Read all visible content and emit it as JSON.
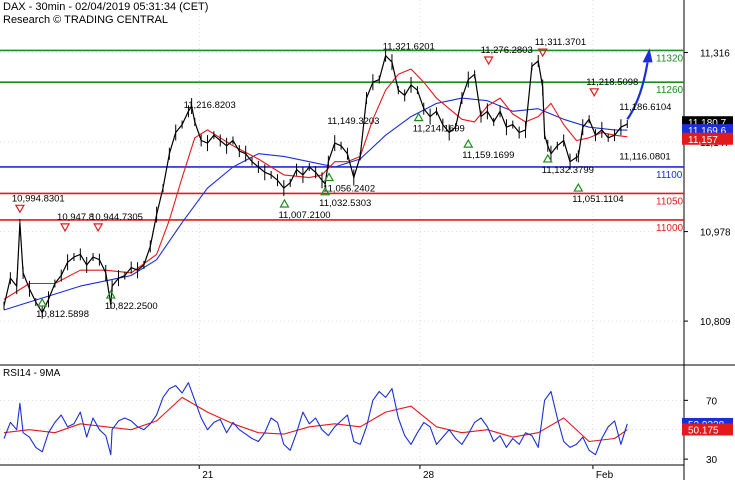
{
  "header": {
    "title": "DAX - 30min - 02/04/2019 05:31:34 (CET)",
    "source": "Research © TRADING CENTRAL"
  },
  "colors": {
    "price": "#000000",
    "ma_fast": "#e31a1c",
    "ma_slow": "#1c2fd6",
    "resistance": "#1e8c1e",
    "pivot": "#1c2fd6",
    "support": "#e31a1c",
    "arrow": "#1c2fd6",
    "up_marker": "#1e8c1e",
    "down_marker": "#e31a1c",
    "rsi": "#1c2fd6",
    "rsi_ma": "#e31a1c",
    "grid": "#c8c8c8"
  },
  "chart_data": [
    {
      "type": "line",
      "panel": "price",
      "ylim": [
        10745,
        11368
      ],
      "xlim": [
        0,
        100
      ],
      "y_ticks": [
        "11,316",
        "11,147",
        "10,978",
        "10,809"
      ],
      "x_ticks": [
        {
          "x": 30.7,
          "label": "21"
        },
        {
          "x": 65.4,
          "label": "28"
        },
        {
          "x": 92.6,
          "label": "Feb"
        }
      ],
      "levels": [
        {
          "value": 11320,
          "label": "11320",
          "kind": "resistance"
        },
        {
          "value": 11260,
          "label": "11260",
          "kind": "resistance"
        },
        {
          "value": 11100,
          "label": "11100",
          "kind": "pivot"
        },
        {
          "value": 11050,
          "label": "11050",
          "kind": "support"
        },
        {
          "value": 11000,
          "label": "11000",
          "kind": "support"
        }
      ],
      "price_tags": [
        {
          "value": 11180.7,
          "label": "11,180.7",
          "color": "#000000"
        },
        {
          "value": 11169.6,
          "label": "11,169.6",
          "color": "#1c2fd6"
        },
        {
          "value": 11157,
          "label": "11,157",
          "color": "#e31a1c"
        }
      ],
      "annotations": [
        {
          "x": 2.5,
          "y": 11020,
          "label": "10,994.8301",
          "marker": "down"
        },
        {
          "x": 9.6,
          "y": 10985,
          "label": "10,947.8",
          "marker": "down"
        },
        {
          "x": 14.8,
          "y": 10985,
          "label": "10,944.7305",
          "marker": "down"
        },
        {
          "x": 6.0,
          "y": 10845,
          "label": "10,812.5898",
          "marker": "up"
        },
        {
          "x": 16.8,
          "y": 10860,
          "label": "10,822.2500",
          "marker": "up"
        },
        {
          "x": 29.5,
          "y": 11200,
          "label": "11,216.8203",
          "marker": "none"
        },
        {
          "x": 60.8,
          "y": 11310,
          "label": "11,321.6201",
          "marker": "none"
        },
        {
          "x": 52.1,
          "y": 11170,
          "label": "11,149.3203",
          "marker": "none"
        },
        {
          "x": 65.2,
          "y": 11195,
          "label": "11,214.1699",
          "marker": "up"
        },
        {
          "x": 73.0,
          "y": 11145,
          "label": "11,159.1699",
          "marker": "up"
        },
        {
          "x": 76.2,
          "y": 11300,
          "label": "11,276.2803",
          "marker": "down"
        },
        {
          "x": 84.7,
          "y": 11315,
          "label": "11,311.3701",
          "marker": "down"
        },
        {
          "x": 92.8,
          "y": 11240,
          "label": "11,218.5098",
          "marker": "down"
        },
        {
          "x": 98.0,
          "y": 11196,
          "label": "11,186.6104",
          "marker": "none"
        },
        {
          "x": 85.5,
          "y": 11117,
          "label": "11,132.3799",
          "marker": "up"
        },
        {
          "x": 98.0,
          "y": 11103,
          "label": "11,116.0801",
          "marker": "none"
        },
        {
          "x": 51.1,
          "y": 11082,
          "label": "11,056.2402",
          "marker": "up"
        },
        {
          "x": 50.5,
          "y": 11055,
          "label": "11,032.5303",
          "marker": "up"
        },
        {
          "x": 44.1,
          "y": 11032,
          "label": "11,007.2100",
          "marker": "up"
        },
        {
          "x": 90.3,
          "y": 11062,
          "label": "11,051.1104",
          "marker": "up"
        }
      ],
      "series": [
        {
          "name": "price",
          "x": [
            0,
            1,
            2,
            2.5,
            3,
            4,
            5,
            6,
            7,
            8,
            9,
            10,
            11,
            12,
            13,
            14,
            15,
            16,
            16.8,
            17,
            18,
            19,
            20,
            21,
            22,
            23,
            24,
            25,
            26,
            27,
            28,
            29,
            29.5,
            30,
            31,
            32,
            33,
            34,
            35,
            36,
            37,
            38,
            39,
            40,
            41,
            42,
            43,
            44,
            45,
            46,
            47,
            48,
            49,
            50,
            50.5,
            51,
            52,
            53,
            54,
            55,
            56,
            57,
            58,
            59,
            60,
            61,
            62,
            63,
            64,
            65,
            66,
            67,
            68,
            69,
            70,
            71,
            72,
            73,
            74,
            75,
            76,
            77,
            78,
            79,
            80,
            81,
            82,
            83,
            84,
            84.7,
            85,
            85.5,
            86,
            87,
            88,
            89,
            90,
            90.3,
            91,
            92,
            93,
            94,
            95,
            96,
            97,
            98
          ],
          "y": [
            10838,
            10890,
            10875,
            10994,
            10900,
            10870,
            10845,
            10825,
            10850,
            10880,
            10895,
            10920,
            10930,
            10935,
            10915,
            10930,
            10925,
            10900,
            10840,
            10875,
            10890,
            10895,
            10910,
            10905,
            10915,
            10950,
            11010,
            11060,
            11125,
            11165,
            11180,
            11205,
            11215,
            11185,
            11150,
            11145,
            11160,
            11150,
            11140,
            11150,
            11130,
            11125,
            11110,
            11100,
            11090,
            11085,
            11075,
            11060,
            11070,
            11095,
            11085,
            11100,
            11090,
            11075,
            11068,
            11110,
            11145,
            11140,
            11125,
            11080,
            11120,
            11230,
            11260,
            11265,
            11310,
            11298,
            11245,
            11235,
            11255,
            11245,
            11210,
            11195,
            11205,
            11180,
            11165,
            11175,
            11230,
            11265,
            11275,
            11195,
            11205,
            11185,
            11205,
            11175,
            11180,
            11165,
            11170,
            11290,
            11300,
            11250,
            11160,
            11140,
            11125,
            11140,
            11150,
            11110,
            11118,
            11120,
            11175,
            11190,
            11160,
            11170,
            11155,
            11160,
            11175,
            11181
          ]
        },
        {
          "name": "ma_fast",
          "x": [
            0,
            4,
            8,
            12,
            16,
            20,
            24,
            26,
            28,
            30,
            32,
            34,
            36,
            40,
            44,
            48,
            50,
            52,
            54,
            56,
            58,
            60,
            62,
            64,
            66,
            68,
            70,
            72,
            74,
            76,
            78,
            80,
            82,
            84,
            86,
            88,
            90,
            92,
            94,
            96,
            98
          ],
          "y": [
            10850,
            10880,
            10880,
            10905,
            10905,
            10900,
            10935,
            11000,
            11080,
            11155,
            11170,
            11155,
            11140,
            11115,
            11085,
            11080,
            11085,
            11110,
            11110,
            11120,
            11190,
            11245,
            11275,
            11285,
            11260,
            11230,
            11210,
            11190,
            11185,
            11215,
            11230,
            11200,
            11185,
            11195,
            11220,
            11180,
            11150,
            11155,
            11165,
            11160,
            11157
          ]
        },
        {
          "name": "ma_slow",
          "x": [
            0,
            4,
            8,
            12,
            16,
            20,
            24,
            28,
            32,
            36,
            40,
            44,
            48,
            52,
            56,
            60,
            64,
            68,
            72,
            76,
            80,
            84,
            88,
            92,
            96,
            98
          ],
          "y": [
            10830,
            10845,
            10860,
            10875,
            10885,
            10895,
            10925,
            10995,
            11060,
            11100,
            11125,
            11120,
            11110,
            11100,
            11115,
            11160,
            11195,
            11220,
            11230,
            11225,
            11205,
            11210,
            11190,
            11175,
            11170,
            11169.6
          ]
        }
      ],
      "forecast_arrow": {
        "x": [
          98,
          101.5
        ],
        "y": [
          11190,
          11320
        ]
      }
    },
    {
      "type": "line",
      "panel": "rsi",
      "title": "RSI14 - 9MA",
      "ylim": [
        26,
        92
      ],
      "y_ticks": [
        "70",
        "50",
        "30"
      ],
      "price_tags": [
        {
          "value": 53.93,
          "label": "53.9328",
          "color": "#1c2fd6"
        },
        {
          "value": 50.18,
          "label": "50.175",
          "color": "#e31a1c"
        }
      ],
      "series": [
        {
          "name": "rsi",
          "x": [
            0,
            1,
            2,
            2.5,
            3,
            4,
            5,
            6,
            7,
            8,
            9,
            10,
            11,
            12,
            13,
            14,
            15,
            16,
            16.8,
            17,
            18,
            19,
            20,
            21,
            22,
            23,
            24,
            25,
            26,
            27,
            28,
            29,
            30,
            31,
            32,
            33,
            34,
            35,
            36,
            37,
            38,
            39,
            40,
            41,
            42,
            43,
            44,
            45,
            46,
            47,
            48,
            49,
            50,
            51,
            52,
            53,
            54,
            55,
            56,
            57,
            58,
            59,
            60,
            61,
            62,
            63,
            64,
            65,
            66,
            67,
            68,
            69,
            70,
            71,
            72,
            73,
            74,
            75,
            76,
            77,
            78,
            79,
            80,
            81,
            82,
            83,
            84,
            85,
            86,
            87,
            88,
            89,
            90,
            91,
            92,
            93,
            94,
            95,
            96,
            97,
            98
          ],
          "y": [
            44,
            55,
            50,
            68,
            48,
            45,
            38,
            35,
            48,
            55,
            60,
            52,
            54,
            62,
            45,
            58,
            50,
            46,
            33,
            50,
            56,
            58,
            56,
            52,
            50,
            54,
            60,
            72,
            78,
            80,
            75,
            82,
            70,
            58,
            50,
            55,
            57,
            48,
            55,
            50,
            47,
            44,
            42,
            48,
            58,
            55,
            40,
            36,
            48,
            62,
            54,
            58,
            50,
            46,
            52,
            56,
            60,
            42,
            40,
            52,
            70,
            76,
            72,
            78,
            58,
            46,
            40,
            48,
            55,
            52,
            40,
            45,
            50,
            44,
            40,
            47,
            55,
            58,
            52,
            42,
            46,
            38,
            44,
            40,
            48,
            46,
            38,
            70,
            76,
            58,
            42,
            38,
            40,
            45,
            36,
            33,
            44,
            52,
            56,
            40,
            54
          ]
        },
        {
          "name": "rsi_ma",
          "x": [
            0,
            4,
            8,
            12,
            16,
            20,
            24,
            28,
            32,
            36,
            40,
            44,
            48,
            52,
            56,
            60,
            64,
            68,
            72,
            76,
            80,
            84,
            88,
            92,
            96,
            98
          ],
          "y": [
            48,
            50,
            48,
            54,
            52,
            50,
            56,
            72,
            62,
            54,
            48,
            47,
            52,
            54,
            52,
            62,
            66,
            52,
            48,
            50,
            45,
            48,
            58,
            42,
            44,
            50
          ]
        }
      ]
    }
  ]
}
